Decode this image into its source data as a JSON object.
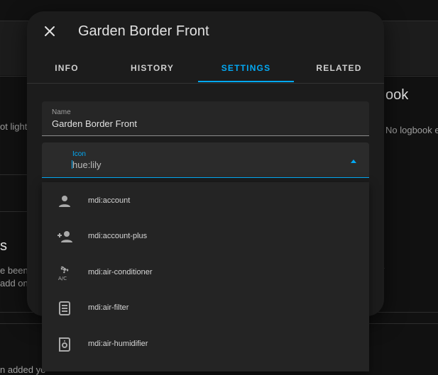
{
  "background": {
    "heading_partial": "ook",
    "side_text_partial": "No logbook e",
    "left_text_1": "ot light",
    "left_heading_partial": "s",
    "left_text_2": "e been",
    "left_text_3": "add one",
    "bottom_text_partial": "n added ye"
  },
  "dialog": {
    "title": "Garden Border Front",
    "tabs": [
      {
        "label": "INFO"
      },
      {
        "label": "HISTORY"
      },
      {
        "label": "SETTINGS"
      },
      {
        "label": "RELATED"
      }
    ],
    "active_tab": "SETTINGS",
    "name_field": {
      "label": "Name",
      "value": "Garden Border Front"
    },
    "icon_field": {
      "label": "Icon",
      "value": "hue:lily"
    }
  },
  "icon_options": [
    {
      "label": "mdi:account",
      "icon": "account-icon"
    },
    {
      "label": "mdi:account-plus",
      "icon": "account-plus-icon"
    },
    {
      "label": "mdi:air-conditioner",
      "icon": "air-conditioner-icon"
    },
    {
      "label": "mdi:air-filter",
      "icon": "air-filter-icon"
    },
    {
      "label": "mdi:air-humidifier",
      "icon": "air-humidifier-icon"
    }
  ],
  "colors": {
    "accent": "#03a9f4",
    "dialog_bg": "#1c1c1c",
    "page_bg": "#111111"
  }
}
